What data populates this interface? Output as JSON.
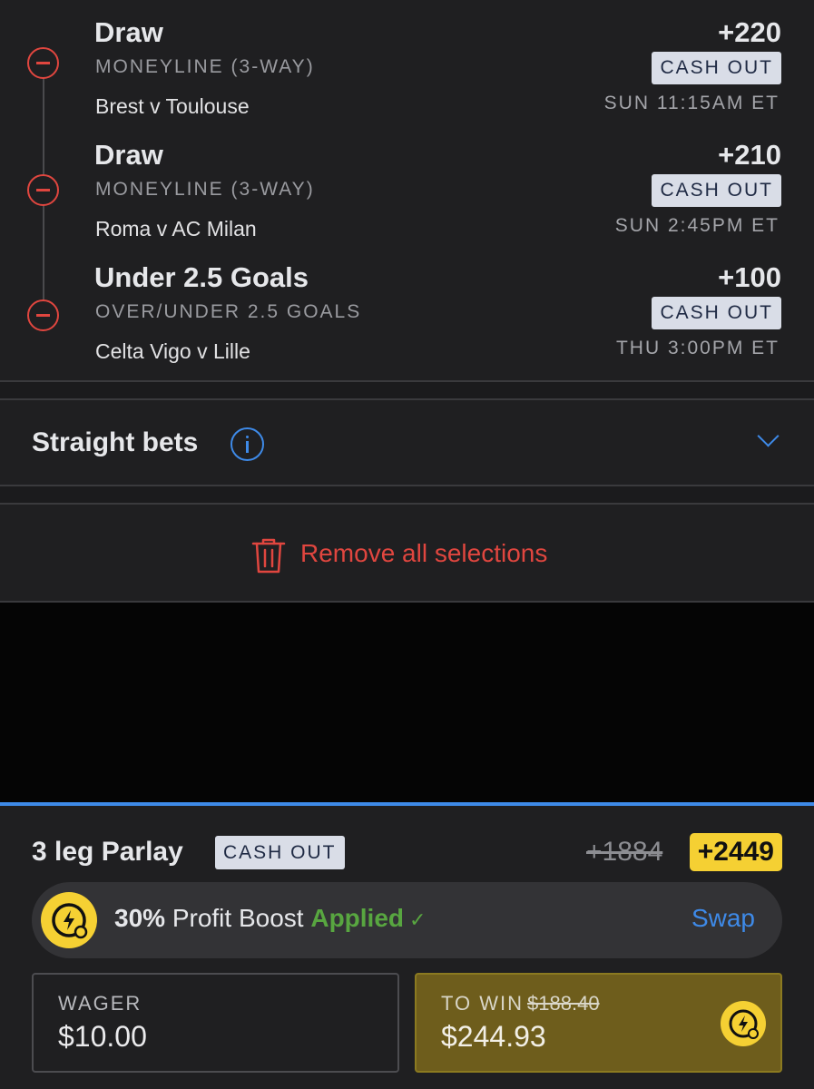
{
  "legs": [
    {
      "selection": "Draw",
      "market": "MONEYLINE (3-WAY)",
      "event": "Brest v Toulouse",
      "odds": "+220",
      "cashout": "CASH OUT",
      "time": "SUN 11:15AM ET"
    },
    {
      "selection": "Draw",
      "market": "MONEYLINE (3-WAY)",
      "event": "Roma v AC Milan",
      "odds": "+210",
      "cashout": "CASH OUT",
      "time": "SUN 2:45PM ET"
    },
    {
      "selection": "Under 2.5 Goals",
      "market": "OVER/UNDER 2.5 GOALS",
      "event": "Celta Vigo v Lille",
      "odds": "+100",
      "cashout": "CASH OUT",
      "time": "THU 3:00PM ET"
    }
  ],
  "straight_bets": {
    "label": "Straight bets",
    "info_icon": "info-icon",
    "toggle_icon": "chevron-down-icon"
  },
  "remove_all": {
    "label": "Remove all selections",
    "icon": "trash-icon"
  },
  "parlay": {
    "title": "3 leg Parlay",
    "cashout": "CASH OUT",
    "old_odds": "+1884",
    "new_odds": "+2449"
  },
  "boost": {
    "percent": "30%",
    "label": "Profit Boost",
    "status": "Applied",
    "check": "✓",
    "swap": "Swap"
  },
  "wager": {
    "label": "WAGER",
    "value": "$10.00"
  },
  "to_win": {
    "label": "TO WIN",
    "old_value": "$188.40",
    "value": "$244.93"
  },
  "colors": {
    "accent_blue": "#3e8ae8",
    "remove_red": "#e0463f",
    "boost_yellow": "#f5d033",
    "applied_green": "#58a640",
    "to_win_bg": "#6e5d1c"
  }
}
